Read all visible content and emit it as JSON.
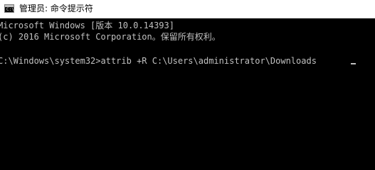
{
  "window": {
    "title": "管理员: 命令提示符",
    "icon": "console-icon",
    "icon_glyph": "C:\\"
  },
  "console": {
    "lines": [
      "Microsoft Windows [版本 10.0.14393]",
      "(c) 2016 Microsoft Corporation。保留所有权利。",
      "C:\\Windows\\system32>attrib +R C:\\Users\\administrator\\Downloads"
    ]
  },
  "colors": {
    "background": "#000000",
    "text": "#c0c0c0",
    "titlebar": "#ffffff"
  }
}
